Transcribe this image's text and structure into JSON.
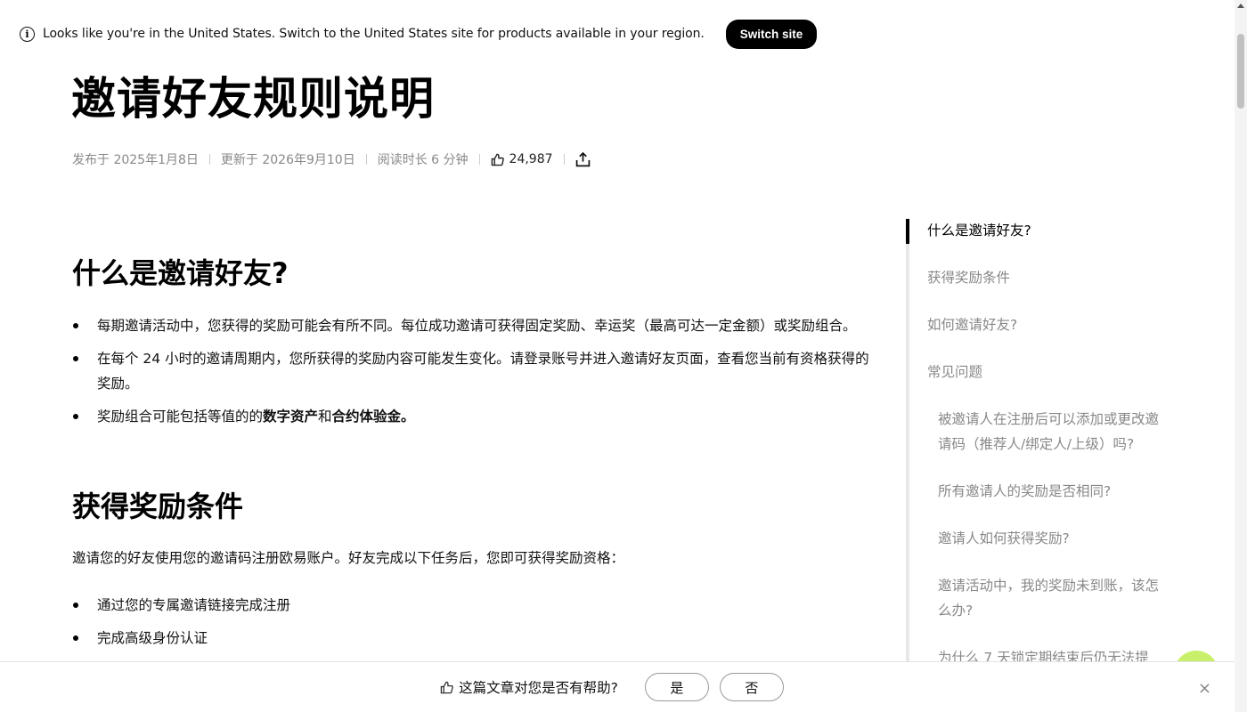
{
  "banner": {
    "message": "Looks like you're in the United States. Switch to the United States site for products available in your region.",
    "switch_label": "Switch site"
  },
  "article": {
    "title": "邀请好友规则说明",
    "published": "发布于 2025年1月8日",
    "updated": "更新于 2026年9月10日",
    "read_time": "阅读时长 6 分钟",
    "likes": "24,987",
    "section1": {
      "heading": "什么是邀请好友?",
      "bullets": [
        "每期邀请活动中，您获得的奖励可能会有所不同。每位成功邀请可获得固定奖励、幸运奖（最高可达一定金额）或奖励组合。",
        "在每个 24 小时的邀请周期内，您所获得的奖励内容可能发生变化。请登录账号并进入邀请好友页面，查看您当前有资格获得的奖励。"
      ],
      "bullet3_prefix": "奖励组合可能包括等值的的",
      "bullet3_bold1": "数字资产",
      "bullet3_mid": "和",
      "bullet3_bold2": "合约体验金。"
    },
    "section2": {
      "heading": "获得奖励条件",
      "intro": "邀请您的好友使用您的邀请码注册欧易账户。好友完成以下任务后，您即可获得奖励资格：",
      "bullets": [
        "通过您的专属邀请链接完成注册",
        "完成高级身份认证"
      ]
    }
  },
  "toc": {
    "items": [
      "什么是邀请好友?",
      "获得奖励条件",
      "如何邀请好友?",
      "常见问题"
    ],
    "sub_items": [
      "被邀请人在注册后可以添加或更改邀请码（推荐人/绑定人/上级）吗?",
      "所有邀请人的奖励是否相同?",
      "邀请人如何获得奖励?",
      "邀请活动中，我的奖励未到账，该怎么办?",
      "为什么 7 天锁定期结束后仍无法提"
    ]
  },
  "feedback": {
    "question": "这篇文章对您是否有帮助?",
    "yes": "是",
    "no": "否",
    "close": "×"
  }
}
